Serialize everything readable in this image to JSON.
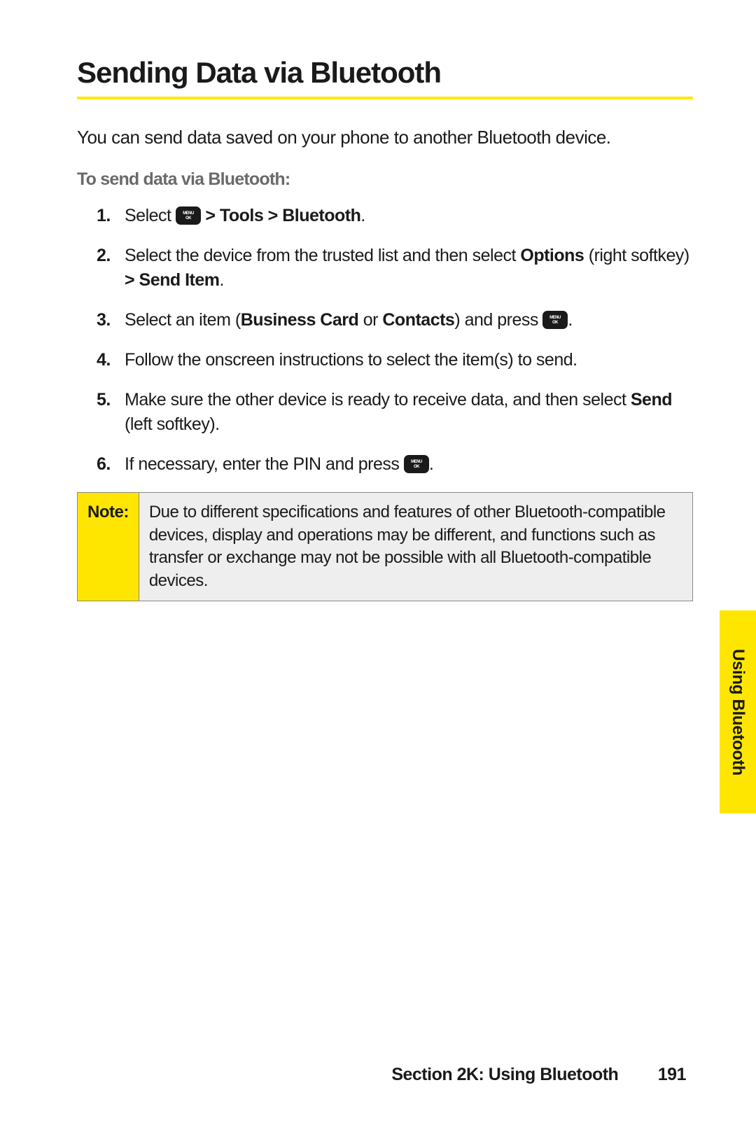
{
  "heading": "Sending Data via Bluetooth",
  "intro": "You can send data saved on your phone to another Bluetooth device.",
  "subhead": "To send data via Bluetooth:",
  "steps": {
    "s1": {
      "num": "1.",
      "pre": "Select ",
      "post1": " > Tools > Bluetooth",
      "post2": "."
    },
    "s2": {
      "num": "2.",
      "a": "Select the device from the trusted list and then select ",
      "b": "Options",
      "c": " (right softkey) ",
      "d": "> Send Item",
      "e": "."
    },
    "s3": {
      "num": "3.",
      "a": "Select an item (",
      "b": "Business Card",
      "c": " or ",
      "d": "Contacts",
      "e": ") and press ",
      "f": "."
    },
    "s4": {
      "num": "4.",
      "a": "Follow the onscreen instructions to select the item(s) to send."
    },
    "s5": {
      "num": "5.",
      "a": "Make sure the other device is ready to receive data, and then select ",
      "b": "Send",
      "c": " (left softkey)."
    },
    "s6": {
      "num": "6.",
      "a": "If necessary, enter the PIN and press ",
      "b": "."
    }
  },
  "note": {
    "label": "Note:",
    "body": "Due to different specifications and features of other Bluetooth-compatible devices, display and operations may be different, and functions such as transfer or exchange may not be possible with all Bluetooth-compatible devices."
  },
  "sideTab": "Using Bluetooth",
  "footer": {
    "section": "Section 2K: Using Bluetooth",
    "page": "191"
  }
}
